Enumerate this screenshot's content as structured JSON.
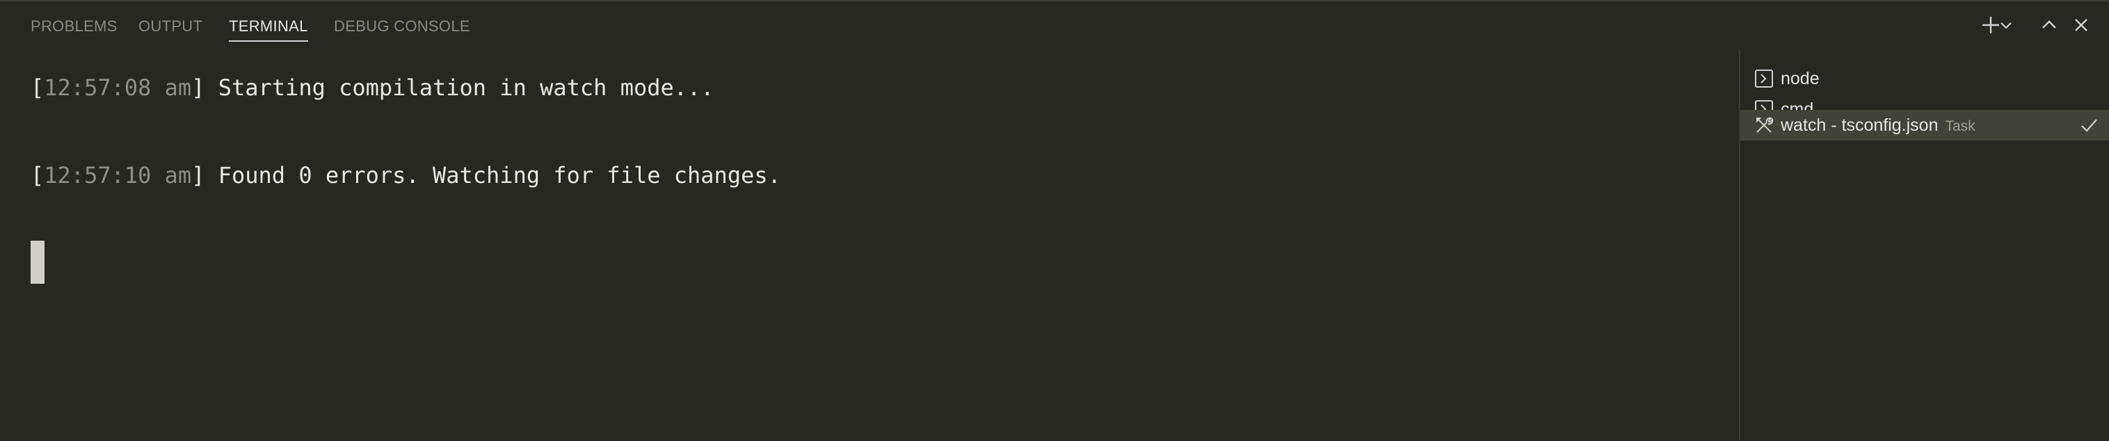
{
  "panel": {
    "tabs": [
      {
        "label": "PROBLEMS",
        "active": false
      },
      {
        "label": "OUTPUT",
        "active": false
      },
      {
        "label": "TERMINAL",
        "active": true
      },
      {
        "label": "DEBUG CONSOLE",
        "active": false
      }
    ],
    "actions": [
      "plus-icon",
      "chevron-down-icon",
      "chevron-up-icon",
      "close-icon"
    ]
  },
  "terminal": {
    "lines": [
      {
        "open": "[",
        "time": "12:57:08 am",
        "close": "]",
        "text": " Starting compilation in watch mode..."
      },
      {
        "open": "[",
        "time": "12:57:10 am",
        "close": "]",
        "text": " Found 0 errors. Watching for file changes."
      }
    ]
  },
  "terminal_list": {
    "items": [
      {
        "label": "node",
        "tag": "",
        "icon": "terminal-icon",
        "selected": false
      },
      {
        "label": "cmd",
        "tag": "",
        "icon": "terminal-icon",
        "selected": false
      },
      {
        "label": "watch - tsconfig.json",
        "tag": "Task",
        "icon": "tools-icon",
        "selected": true,
        "status_icon": "check-icon"
      }
    ]
  },
  "colors": {
    "background": "#272822",
    "selected_row": "#414339",
    "timestamp": "#8f8f85"
  }
}
